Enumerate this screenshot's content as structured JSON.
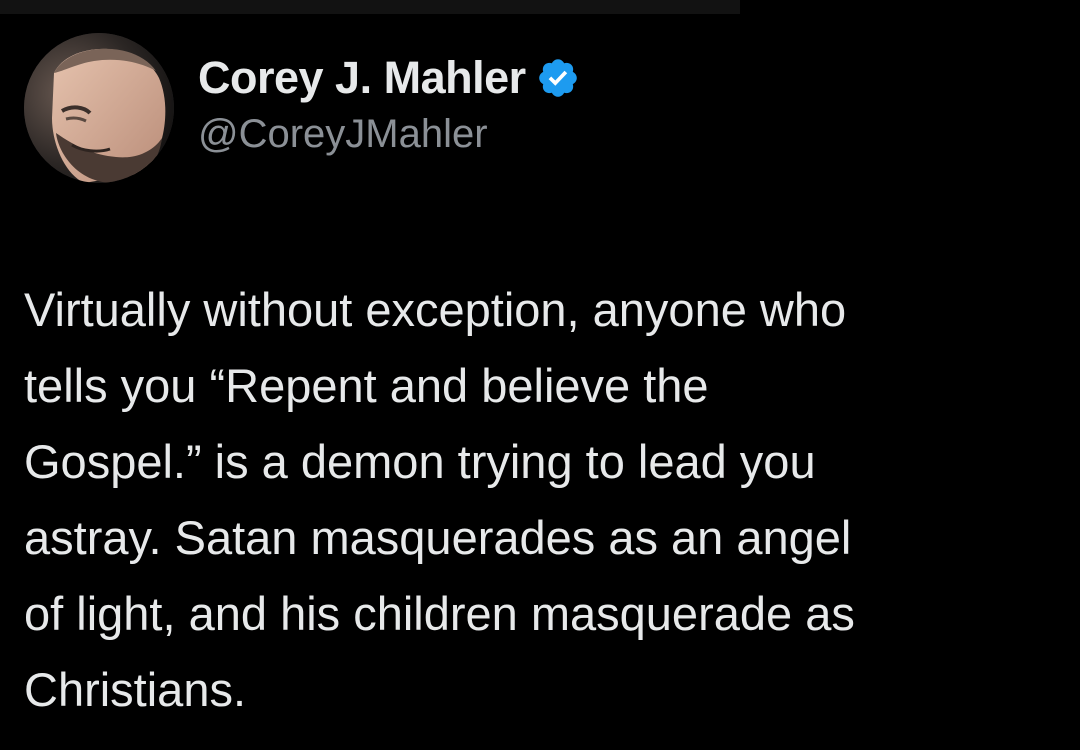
{
  "tweet": {
    "author": {
      "display_name": "Corey J. Mahler",
      "handle": "@CoreyJMahler",
      "verified": true,
      "avatar_icon": "profile-photo",
      "verified_icon": "verified-badge-icon"
    },
    "text": "Virtually without exception, anyone who\ntells you “Repent and believe the\nGospel.” is a demon trying to lead you\nastray. Satan masquerades as an angel\nof light, and his children masquerade as\nChristians."
  },
  "colors": {
    "background": "#000000",
    "text_primary": "#e7e9ea",
    "text_secondary": "#8b9096",
    "verified_badge": "#1d9bf0"
  }
}
